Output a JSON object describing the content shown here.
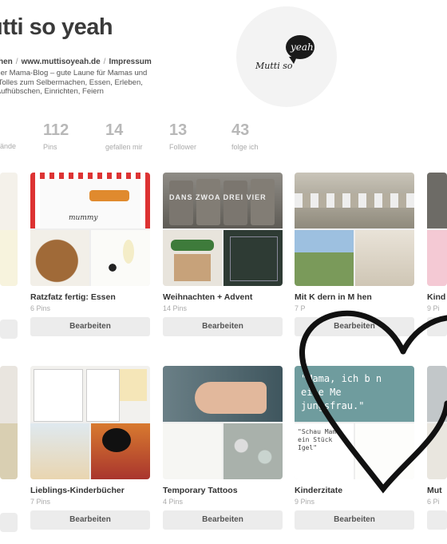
{
  "profile": {
    "name": "utti so yeah",
    "link_1": "hen",
    "link_2": "www.muttisoyeah.de",
    "link_3": "Impressum",
    "desc_1": "nner Mama-Blog – gute Laune für Mamas und",
    "desc_2": "– Tolles zum Selbermachen, Essen, Erleben,",
    "desc_3": ", Aufhübschen, Einrichten, Feiern",
    "avatar_bubble": "yeah",
    "avatar_text": "Mutti so"
  },
  "stats": [
    {
      "value": "",
      "label": "ände"
    },
    {
      "value": "112",
      "label": "Pins"
    },
    {
      "value": "14",
      "label": "gefallen mir"
    },
    {
      "value": "13",
      "label": "Follower"
    },
    {
      "value": "43",
      "label": "folge ich"
    }
  ],
  "boards": [
    {
      "title": "Ratzfatz fertig: Essen",
      "pins": "6 Pins",
      "button": "Bearbeiten",
      "cover_text": "mummy"
    },
    {
      "title": "Weihnachten + Advent",
      "pins": "14 Pins",
      "button": "Bearbeiten",
      "cover_text": "DANS ZWOA DREI VIER"
    },
    {
      "title": "Mit K    dern in M    hen",
      "pins": "7 P",
      "button": "Bearbeiten"
    },
    {
      "title": "Kind",
      "pins": "9 Pi",
      "button": ""
    },
    {
      "title": "Lieblings-Kinderbücher",
      "pins": "7 Pins",
      "button": "Bearbeiten"
    },
    {
      "title": "Temporary Tattoos",
      "pins": "4 Pins",
      "button": "Bearbeiten"
    },
    {
      "title": "Kinderzitate",
      "pins": "9 Pins",
      "button": "Bearbeiten",
      "quote": "\"Mama, ich b  n eine Me  jungsfrau.\"",
      "quote_2": "\"Schau Mama, ein Stück Igel\""
    },
    {
      "title": "Mut",
      "pins": "6 Pi",
      "button": ""
    }
  ],
  "colors": {
    "heart": "#111111",
    "button_bg": "#ececec"
  }
}
